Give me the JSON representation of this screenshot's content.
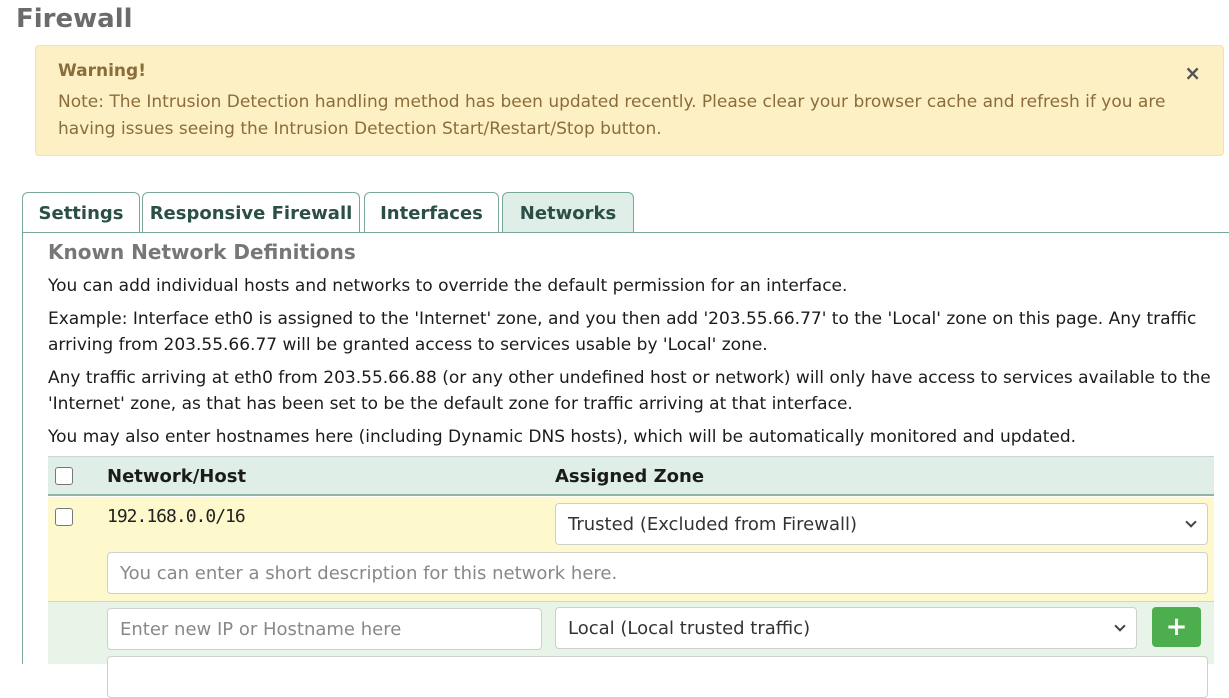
{
  "page": {
    "title": "Firewall"
  },
  "alert": {
    "heading": "Warning!",
    "text": "Note: The Intrusion Detection handling method has been updated recently. Please clear your browser cache and refresh if you are having issues seeing the Intrusion Detection Start/Restart/Stop button.",
    "close_symbol": "×"
  },
  "tabs": [
    {
      "label": "Settings",
      "active": false
    },
    {
      "label": "Responsive Firewall",
      "active": false
    },
    {
      "label": "Interfaces",
      "active": false
    },
    {
      "label": "Networks",
      "active": true
    }
  ],
  "section": {
    "title": "Known Network Definitions",
    "paragraphs": [
      "You can add individual hosts and networks to override the default permission for an interface.",
      "Example: Interface eth0 is assigned to the 'Internet' zone, and you then add '203.55.66.77' to the 'Local' zone on this page. Any traffic arriving from 203.55.66.77 will be granted access to services usable by 'Local' zone.",
      "Any traffic arriving at eth0 from 203.55.66.88 (or any other undefined host or network) will only have access to services available to the 'Internet' zone, as that has been set to be the default zone for traffic arriving at that interface.",
      "You may also enter hostnames here (including Dynamic DNS hosts), which will be automatically monitored and updated."
    ]
  },
  "table": {
    "headers": {
      "network": "Network/Host",
      "zone": "Assigned Zone"
    },
    "rows": [
      {
        "network": "192.168.0.0/16",
        "zone": "Trusted (Excluded from Firewall)",
        "description_placeholder": "You can enter a short description for this network here."
      }
    ],
    "new_row": {
      "ip_placeholder": "Enter new IP or Hostname here",
      "zone": "Local (Local trusted traffic)",
      "add_label": "+"
    }
  },
  "icons": {
    "close": "close-icon",
    "add": "plus-icon",
    "chevron": "chevron-down-icon"
  },
  "colors": {
    "alert_bg": "#fdf0c4",
    "alert_text": "#8a6d3b",
    "tab_active_bg": "#dfeee7",
    "add_button": "#4cae4c"
  }
}
